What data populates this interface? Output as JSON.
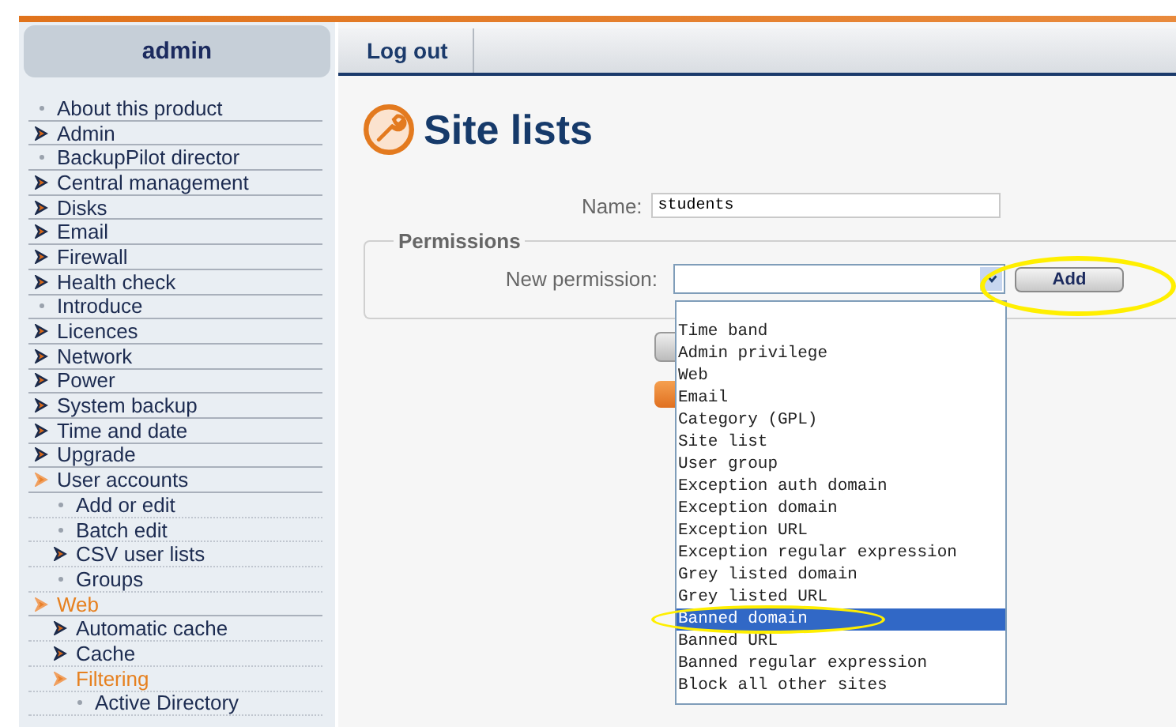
{
  "sidebar": {
    "title": "admin",
    "items": [
      {
        "label": "About this product",
        "kind": "dot",
        "selected": false
      },
      {
        "label": "Admin",
        "kind": "arrow",
        "expanded": false,
        "selected": false
      },
      {
        "label": "BackupPilot director",
        "kind": "dot",
        "selected": false
      },
      {
        "label": "Central management",
        "kind": "arrow",
        "expanded": false,
        "selected": false
      },
      {
        "label": "Disks",
        "kind": "arrow",
        "expanded": false,
        "selected": false
      },
      {
        "label": "Email",
        "kind": "arrow",
        "expanded": false,
        "selected": false
      },
      {
        "label": "Firewall",
        "kind": "arrow",
        "expanded": false,
        "selected": false
      },
      {
        "label": "Health check",
        "kind": "arrow",
        "expanded": false,
        "selected": false
      },
      {
        "label": "Introduce",
        "kind": "dot",
        "selected": false
      },
      {
        "label": "Licences",
        "kind": "arrow",
        "expanded": false,
        "selected": false
      },
      {
        "label": "Network",
        "kind": "arrow",
        "expanded": false,
        "selected": false
      },
      {
        "label": "Power",
        "kind": "arrow",
        "expanded": false,
        "selected": false
      },
      {
        "label": "System backup",
        "kind": "arrow",
        "expanded": false,
        "selected": false
      },
      {
        "label": "Time and date",
        "kind": "arrow",
        "expanded": false,
        "selected": false
      },
      {
        "label": "Upgrade",
        "kind": "arrow",
        "expanded": false,
        "selected": false
      },
      {
        "label": "User accounts",
        "kind": "arrow",
        "expanded": true,
        "selected": false,
        "children": [
          {
            "label": "Add or edit",
            "kind": "dot",
            "selected": false
          },
          {
            "label": "Batch edit",
            "kind": "dot",
            "selected": false
          },
          {
            "label": "CSV user lists",
            "kind": "arrow",
            "expanded": false,
            "selected": false
          },
          {
            "label": "Groups",
            "kind": "dot",
            "selected": false
          }
        ]
      },
      {
        "label": "Web",
        "kind": "arrow",
        "expanded": true,
        "selected": true,
        "children": [
          {
            "label": "Automatic cache",
            "kind": "arrow",
            "expanded": false,
            "selected": false
          },
          {
            "label": "Cache",
            "kind": "arrow",
            "expanded": false,
            "selected": false
          },
          {
            "label": "Filtering",
            "kind": "arrow",
            "expanded": true,
            "selected": true,
            "children": [
              {
                "label": "Active Directory",
                "kind": "dot",
                "selected": false
              }
            ]
          }
        ]
      }
    ]
  },
  "tabs": [
    {
      "label": "Log out"
    }
  ],
  "page": {
    "title": "Site lists",
    "name_field": {
      "label": "Name:",
      "value": "students"
    },
    "permissions": {
      "legend": "Permissions",
      "label": "New permission:",
      "add_button": "Add",
      "options": [
        {
          "label": "Time band",
          "selected": false
        },
        {
          "label": "Admin privilege",
          "selected": false
        },
        {
          "label": "Web",
          "selected": false
        },
        {
          "label": "Email",
          "selected": false
        },
        {
          "label": "Category (GPL)",
          "selected": false
        },
        {
          "label": "Site list",
          "selected": false
        },
        {
          "label": "User group",
          "selected": false
        },
        {
          "label": "Exception auth domain",
          "selected": false
        },
        {
          "label": "Exception domain",
          "selected": false
        },
        {
          "label": "Exception URL",
          "selected": false
        },
        {
          "label": "Exception regular expression",
          "selected": false
        },
        {
          "label": "Grey listed domain",
          "selected": false
        },
        {
          "label": "Grey listed URL",
          "selected": false
        },
        {
          "label": "Banned domain",
          "selected": true
        },
        {
          "label": "Banned URL",
          "selected": false
        },
        {
          "label": "Banned regular expression",
          "selected": false
        },
        {
          "label": "Block all other sites",
          "selected": false
        }
      ]
    }
  }
}
